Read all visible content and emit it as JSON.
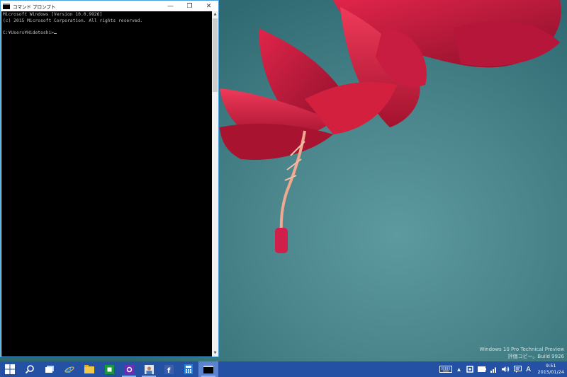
{
  "window": {
    "title": "コマンド プロンプト",
    "controls": {
      "minimize": "—",
      "restore": "❐",
      "close": "✕"
    }
  },
  "console": {
    "line1": "Microsoft Windows [Version 10.0.9926]",
    "line2": "(c) 2015 Microsoft Corporation. All rights reserved.",
    "line3": "",
    "prompt": "C:¥Users¥Hidetoshi>"
  },
  "watermark": {
    "line1": "Windows 10 Pro Technical Preview",
    "line2": "評価コピー。Build 9926"
  },
  "taskbar": {
    "icons": [
      "windows-start-icon",
      "search-icon",
      "task-view-icon",
      "internet-explorer-icon",
      "file-explorer-icon",
      "store-icon",
      "settings-icon",
      "photo-app-icon",
      "facebook-icon",
      "calculator-icon",
      "command-prompt-icon"
    ],
    "tray": {
      "ime": "A",
      "time": "9:51",
      "date": "2015/01/24"
    }
  },
  "colors": {
    "taskbar": "#2451a4",
    "taskbar_active": "#5c83cf",
    "window_border": "#4aa3df",
    "console_bg": "#000000",
    "console_text": "#c0c0c0"
  }
}
